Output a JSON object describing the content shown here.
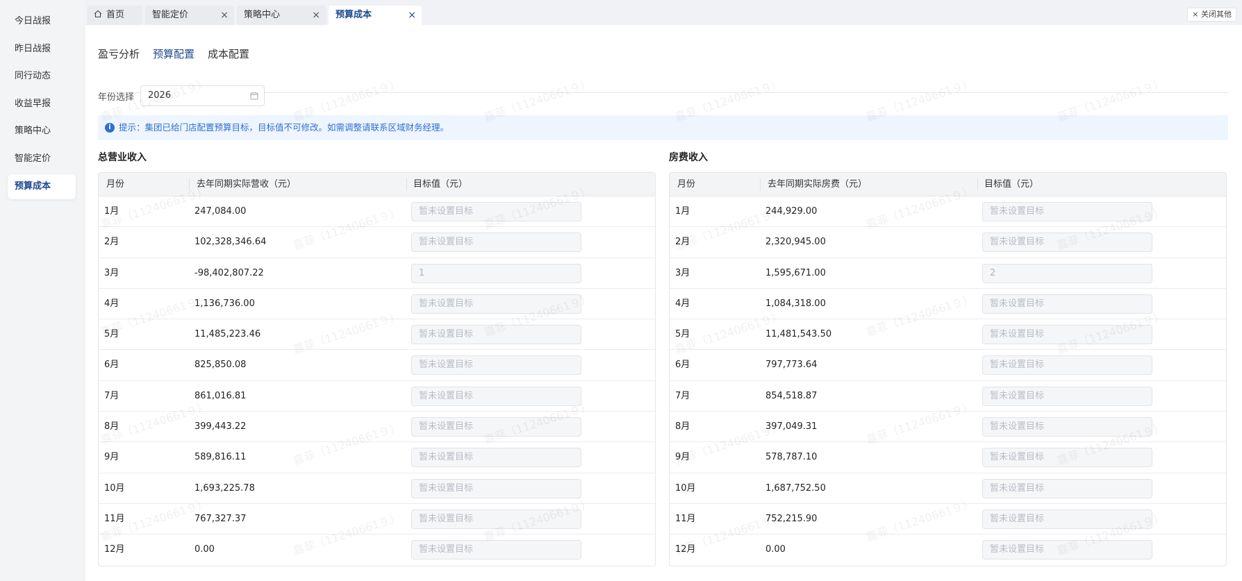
{
  "sidebar": {
    "items": [
      {
        "label": "今日战报"
      },
      {
        "label": "昨日战报"
      },
      {
        "label": "同行动态"
      },
      {
        "label": "收益早报"
      },
      {
        "label": "策略中心"
      },
      {
        "label": "智能定价"
      },
      {
        "label": "预算成本",
        "active": true
      }
    ]
  },
  "tabs": {
    "items": [
      {
        "label": "首页",
        "icon": "home-icon"
      },
      {
        "label": "智能定价"
      },
      {
        "label": "策略中心"
      },
      {
        "label": "预算成本",
        "active": true
      }
    ],
    "close_glyph": "×",
    "close_others_label": "关闭其他"
  },
  "subtabs": [
    {
      "label": "盈亏分析"
    },
    {
      "label": "预算配置",
      "active": true
    },
    {
      "label": "成本配置"
    }
  ],
  "year": {
    "label": "年份选择",
    "value": "2026"
  },
  "alert": {
    "text": "提示：集团已给门店配置预算目标，目标值不可修改。如需调整请联系区域财务经理。"
  },
  "watermark": "嘉菲（11240661９）",
  "revenue_table": {
    "title": "总营业收入",
    "headers": {
      "month": "月份",
      "last_year": "去年同期实际营收（元）",
      "target": "目标值（元）"
    },
    "rows": [
      {
        "month": "1月",
        "last_year": "247,084.00",
        "target": "",
        "placeholder": "暂未设置目标"
      },
      {
        "month": "2月",
        "last_year": "102,328,346.64",
        "target": "",
        "placeholder": "暂未设置目标"
      },
      {
        "month": "3月",
        "last_year": "-98,402,807.22",
        "target": "1",
        "placeholder": "暂未设置目标"
      },
      {
        "month": "4月",
        "last_year": "1,136,736.00",
        "target": "",
        "placeholder": "暂未设置目标"
      },
      {
        "month": "5月",
        "last_year": "11,485,223.46",
        "target": "",
        "placeholder": "暂未设置目标"
      },
      {
        "month": "6月",
        "last_year": "825,850.08",
        "target": "",
        "placeholder": "暂未设置目标"
      },
      {
        "month": "7月",
        "last_year": "861,016.81",
        "target": "",
        "placeholder": "暂未设置目标"
      },
      {
        "month": "8月",
        "last_year": "399,443.22",
        "target": "",
        "placeholder": "暂未设置目标"
      },
      {
        "month": "9月",
        "last_year": "589,816.11",
        "target": "",
        "placeholder": "暂未设置目标"
      },
      {
        "month": "10月",
        "last_year": "1,693,225.78",
        "target": "",
        "placeholder": "暂未设置目标"
      },
      {
        "month": "11月",
        "last_year": "767,327.37",
        "target": "",
        "placeholder": "暂未设置目标"
      },
      {
        "month": "12月",
        "last_year": "0.00",
        "target": "",
        "placeholder": "暂未设置目标"
      }
    ]
  },
  "room_table": {
    "title": "房费收入",
    "headers": {
      "month": "月份",
      "last_year": "去年同期实际房费（元）",
      "target": "目标值（元）"
    },
    "rows": [
      {
        "month": "1月",
        "last_year": "244,929.00",
        "target": "",
        "placeholder": "暂未设置目标"
      },
      {
        "month": "2月",
        "last_year": "2,320,945.00",
        "target": "",
        "placeholder": "暂未设置目标"
      },
      {
        "month": "3月",
        "last_year": "1,595,671.00",
        "target": "2",
        "placeholder": "暂未设置目标"
      },
      {
        "month": "4月",
        "last_year": "1,084,318.00",
        "target": "",
        "placeholder": "暂未设置目标"
      },
      {
        "month": "5月",
        "last_year": "11,481,543.50",
        "target": "",
        "placeholder": "暂未设置目标"
      },
      {
        "month": "6月",
        "last_year": "797,773.64",
        "target": "",
        "placeholder": "暂未设置目标"
      },
      {
        "month": "7月",
        "last_year": "854,518.87",
        "target": "",
        "placeholder": "暂未设置目标"
      },
      {
        "month": "8月",
        "last_year": "397,049.31",
        "target": "",
        "placeholder": "暂未设置目标"
      },
      {
        "month": "9月",
        "last_year": "578,787.10",
        "target": "",
        "placeholder": "暂未设置目标"
      },
      {
        "month": "10月",
        "last_year": "1,687,752.50",
        "target": "",
        "placeholder": "暂未设置目标"
      },
      {
        "month": "11月",
        "last_year": "752,215.90",
        "target": "",
        "placeholder": "暂未设置目标"
      },
      {
        "month": "12月",
        "last_year": "0.00",
        "target": "",
        "placeholder": "暂未设置目标"
      }
    ]
  },
  "colors": {
    "accent": "#1d4a8f",
    "alert_bg": "#eef5ff",
    "alert_text": "#2f6fd1"
  }
}
